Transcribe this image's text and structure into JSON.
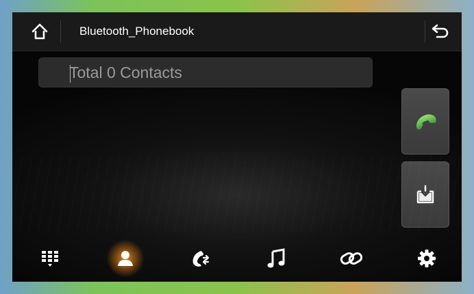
{
  "header": {
    "title": "Bluetooth_Phonebook",
    "home_icon": "home-icon",
    "back_icon": "back-arrow-icon"
  },
  "search": {
    "placeholder": "Total 0 Contacts",
    "value": ""
  },
  "side_actions": [
    {
      "name": "call",
      "icon": "phone-icon",
      "color": "#6cc24a"
    },
    {
      "name": "download-contacts",
      "icon": "download-box-icon"
    }
  ],
  "bottom_nav": {
    "active_index": 1,
    "accent": "#ff9a2e",
    "items": [
      {
        "name": "dialpad",
        "icon": "dialpad-icon"
      },
      {
        "name": "contacts",
        "icon": "contact-person-icon"
      },
      {
        "name": "call-log",
        "icon": "call-log-icon"
      },
      {
        "name": "music",
        "icon": "music-note-icon"
      },
      {
        "name": "pairing",
        "icon": "link-icon"
      },
      {
        "name": "settings",
        "icon": "gear-icon"
      }
    ]
  }
}
